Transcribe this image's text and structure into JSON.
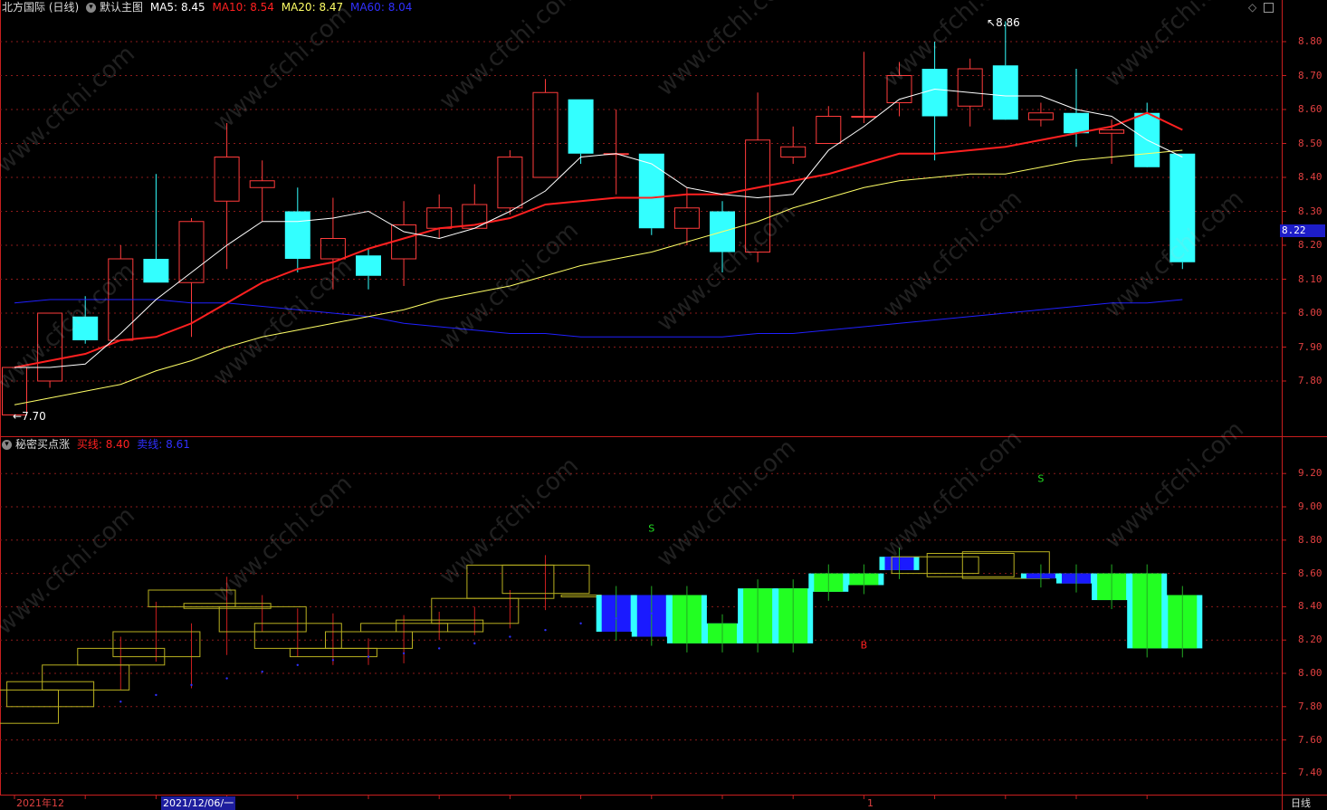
{
  "upper_header": {
    "stock": "北方国际 (日线)",
    "template": "默认主图",
    "ma5_label": "MA5:",
    "ma5_value": "8.45",
    "ma10_label": "MA10:",
    "ma10_value": "8.54",
    "ma20_label": "MA20:",
    "ma20_value": "8.47",
    "ma60_label": "MA60:",
    "ma60_value": "8.04"
  },
  "lower_header": {
    "indicator": "秘密买点涨",
    "buy_label": "买线:",
    "buy_value": "8.40",
    "sell_label": "卖线:",
    "sell_value": "8.61"
  },
  "annotations": {
    "high": "8.86",
    "low": "7.70",
    "current_price": "8.22",
    "signal_sell": "S",
    "signal_buy": "B"
  },
  "price_axis_ticks": [
    "8.80",
    "8.70",
    "8.60",
    "8.50",
    "8.40",
    "8.30",
    "8.20",
    "8.10",
    "8.00",
    "7.90",
    "7.80"
  ],
  "indicator_axis_ticks": [
    "9.20",
    "9.00",
    "8.80",
    "8.60",
    "8.40",
    "8.20",
    "8.00",
    "7.80",
    "7.60",
    "7.40"
  ],
  "bottom_bar": {
    "month_label": "2021年12",
    "cursor_date": "2021/12/06/一",
    "tick_1": "1",
    "period": "日线"
  },
  "watermark": "www.cfchi.com",
  "colors": {
    "up": "#ff3b3b",
    "down": "#33ffff",
    "ma5": "#ffffff",
    "ma10": "#ff2020",
    "ma20": "#ffff66",
    "ma60": "#2020ff",
    "axis": "#c81e1e"
  },
  "chart_data": {
    "type": "candlestick",
    "price_range": [
      7.7,
      8.86
    ],
    "candles": [
      {
        "o": 7.7,
        "h": 7.84,
        "l": 7.7,
        "c": 7.84
      },
      {
        "o": 7.8,
        "h": 8.0,
        "l": 7.78,
        "c": 8.0
      },
      {
        "o": 7.99,
        "h": 8.05,
        "l": 7.91,
        "c": 7.92
      },
      {
        "o": 7.92,
        "h": 8.2,
        "l": 7.92,
        "c": 8.16
      },
      {
        "o": 8.16,
        "h": 8.41,
        "l": 8.09,
        "c": 8.09
      },
      {
        "o": 8.09,
        "h": 8.28,
        "l": 7.93,
        "c": 8.27
      },
      {
        "o": 8.33,
        "h": 8.56,
        "l": 8.13,
        "c": 8.46
      },
      {
        "o": 8.37,
        "h": 8.45,
        "l": 8.27,
        "c": 8.39
      },
      {
        "o": 8.3,
        "h": 8.37,
        "l": 8.12,
        "c": 8.16
      },
      {
        "o": 8.16,
        "h": 8.34,
        "l": 8.07,
        "c": 8.22
      },
      {
        "o": 8.17,
        "h": 8.19,
        "l": 8.07,
        "c": 8.11
      },
      {
        "o": 8.16,
        "h": 8.33,
        "l": 8.08,
        "c": 8.26
      },
      {
        "o": 8.25,
        "h": 8.35,
        "l": 8.22,
        "c": 8.31
      },
      {
        "o": 8.25,
        "h": 8.38,
        "l": 8.25,
        "c": 8.32
      },
      {
        "o": 8.31,
        "h": 8.48,
        "l": 8.29,
        "c": 8.46
      },
      {
        "o": 8.4,
        "h": 8.69,
        "l": 8.4,
        "c": 8.65
      },
      {
        "o": 8.63,
        "h": 8.63,
        "l": 8.44,
        "c": 8.47
      },
      {
        "o": 8.47,
        "h": 8.6,
        "l": 8.35,
        "c": 8.47
      },
      {
        "o": 8.47,
        "h": 8.47,
        "l": 8.23,
        "c": 8.25
      },
      {
        "o": 8.25,
        "h": 8.37,
        "l": 8.2,
        "c": 8.31
      },
      {
        "o": 8.3,
        "h": 8.33,
        "l": 8.12,
        "c": 8.18
      },
      {
        "o": 8.18,
        "h": 8.65,
        "l": 8.15,
        "c": 8.51
      },
      {
        "o": 8.46,
        "h": 8.55,
        "l": 8.44,
        "c": 8.49
      },
      {
        "o": 8.5,
        "h": 8.61,
        "l": 8.5,
        "c": 8.58
      },
      {
        "o": 8.58,
        "h": 8.77,
        "l": 8.56,
        "c": 8.58
      },
      {
        "o": 8.62,
        "h": 8.74,
        "l": 8.58,
        "c": 8.7
      },
      {
        "o": 8.72,
        "h": 8.8,
        "l": 8.45,
        "c": 8.58
      },
      {
        "o": 8.61,
        "h": 8.75,
        "l": 8.55,
        "c": 8.72
      },
      {
        "o": 8.73,
        "h": 8.86,
        "l": 8.58,
        "c": 8.57
      },
      {
        "o": 8.57,
        "h": 8.62,
        "l": 8.55,
        "c": 8.59
      },
      {
        "o": 8.59,
        "h": 8.72,
        "l": 8.49,
        "c": 8.53
      },
      {
        "o": 8.53,
        "h": 8.57,
        "l": 8.44,
        "c": 8.54
      },
      {
        "o": 8.59,
        "h": 8.62,
        "l": 8.45,
        "c": 8.43
      },
      {
        "o": 8.47,
        "h": 8.47,
        "l": 8.13,
        "c": 8.15
      }
    ],
    "ma5": [
      7.84,
      7.84,
      7.85,
      7.94,
      8.04,
      8.12,
      8.2,
      8.27,
      8.27,
      8.28,
      8.3,
      8.24,
      8.22,
      8.25,
      8.3,
      8.36,
      8.46,
      8.47,
      8.44,
      8.37,
      8.35,
      8.34,
      8.35,
      8.48,
      8.55,
      8.63,
      8.66,
      8.65,
      8.64,
      8.64,
      8.6,
      8.58,
      8.51,
      8.46
    ],
    "ma10": [
      7.84,
      7.86,
      7.88,
      7.92,
      7.93,
      7.97,
      8.03,
      8.09,
      8.13,
      8.15,
      8.19,
      8.22,
      8.25,
      8.26,
      8.28,
      8.32,
      8.33,
      8.34,
      8.34,
      8.35,
      8.35,
      8.37,
      8.39,
      8.41,
      8.44,
      8.47,
      8.47,
      8.48,
      8.49,
      8.51,
      8.53,
      8.55,
      8.59,
      8.54
    ],
    "ma20": [
      7.73,
      7.75,
      7.77,
      7.79,
      7.83,
      7.86,
      7.9,
      7.93,
      7.95,
      7.97,
      7.99,
      8.01,
      8.04,
      8.06,
      8.08,
      8.11,
      8.14,
      8.16,
      8.18,
      8.21,
      8.24,
      8.27,
      8.31,
      8.34,
      8.37,
      8.39,
      8.4,
      8.41,
      8.41,
      8.43,
      8.45,
      8.46,
      8.47,
      8.48
    ],
    "ma60": [
      8.03,
      8.04,
      8.04,
      8.04,
      8.04,
      8.03,
      8.03,
      8.02,
      8.01,
      8.0,
      7.99,
      7.97,
      7.96,
      7.95,
      7.94,
      7.94,
      7.93,
      7.93,
      7.93,
      7.93,
      7.93,
      7.94,
      7.94,
      7.95,
      7.96,
      7.97,
      7.98,
      7.99,
      8.0,
      8.01,
      8.02,
      8.03,
      8.03,
      8.04
    ],
    "indicator_range": [
      7.4,
      9.2
    ],
    "indicator_boxes": [
      {
        "a": 7.7,
        "b": 7.9,
        "kind": "hollow"
      },
      {
        "a": 7.8,
        "b": 7.95,
        "kind": "hollow"
      },
      {
        "a": 7.9,
        "b": 8.05,
        "kind": "hollow"
      },
      {
        "a": 8.05,
        "b": 8.15,
        "kind": "hollow"
      },
      {
        "a": 8.1,
        "b": 8.25,
        "kind": "hollow"
      },
      {
        "a": 8.4,
        "b": 8.5,
        "kind": "hollow"
      },
      {
        "a": 8.39,
        "b": 8.42,
        "kind": "hollow"
      },
      {
        "a": 8.25,
        "b": 8.4,
        "kind": "hollow"
      },
      {
        "a": 8.15,
        "b": 8.3,
        "kind": "hollow"
      },
      {
        "a": 8.1,
        "b": 8.15,
        "kind": "hollow"
      },
      {
        "a": 8.15,
        "b": 8.25,
        "kind": "hollow"
      },
      {
        "a": 8.25,
        "b": 8.3,
        "kind": "hollow"
      },
      {
        "a": 8.25,
        "b": 8.32,
        "kind": "hollow"
      },
      {
        "a": 8.3,
        "b": 8.45,
        "kind": "hollow"
      },
      {
        "a": 8.45,
        "b": 8.65,
        "kind": "hollow"
      },
      {
        "a": 8.48,
        "b": 8.65,
        "kind": "hollow"
      },
      {
        "a": 8.47,
        "b": 8.47,
        "kind": "flat"
      },
      {
        "a": 8.25,
        "b": 8.47,
        "kind": "blue"
      },
      {
        "a": 8.22,
        "b": 8.47,
        "kind": "blue"
      },
      {
        "a": 8.18,
        "b": 8.47,
        "kind": "green"
      },
      {
        "a": 8.18,
        "b": 8.3,
        "kind": "green"
      },
      {
        "a": 8.18,
        "b": 8.51,
        "kind": "green"
      },
      {
        "a": 8.18,
        "b": 8.51,
        "kind": "green"
      },
      {
        "a": 8.49,
        "b": 8.6,
        "kind": "green"
      },
      {
        "a": 8.53,
        "b": 8.6,
        "kind": "green"
      },
      {
        "a": 8.62,
        "b": 8.7,
        "kind": "blue"
      },
      {
        "a": 8.6,
        "b": 8.7,
        "kind": "hollow"
      },
      {
        "a": 8.58,
        "b": 8.72,
        "kind": "hollow"
      },
      {
        "a": 8.57,
        "b": 8.73,
        "kind": "hollow"
      },
      {
        "a": 8.57,
        "b": 8.6,
        "kind": "blue"
      },
      {
        "a": 8.54,
        "b": 8.6,
        "kind": "blue"
      },
      {
        "a": 8.44,
        "b": 8.6,
        "kind": "green"
      },
      {
        "a": 8.15,
        "b": 8.6,
        "kind": "green"
      },
      {
        "a": 8.15,
        "b": 8.47,
        "kind": "green"
      }
    ],
    "indicator_dots": [
      7.83,
      7.87,
      7.93,
      7.97,
      8.01,
      8.05,
      8.08,
      8.1,
      8.12,
      8.15,
      8.18,
      8.22,
      8.26,
      8.3,
      8.33,
      8.36
    ],
    "sell_signals": [
      {
        "i": 18,
        "v": 8.85
      },
      {
        "i": 29,
        "v": 9.15
      }
    ],
    "buy_signals": [
      {
        "i": 24,
        "v": 8.15
      }
    ]
  }
}
